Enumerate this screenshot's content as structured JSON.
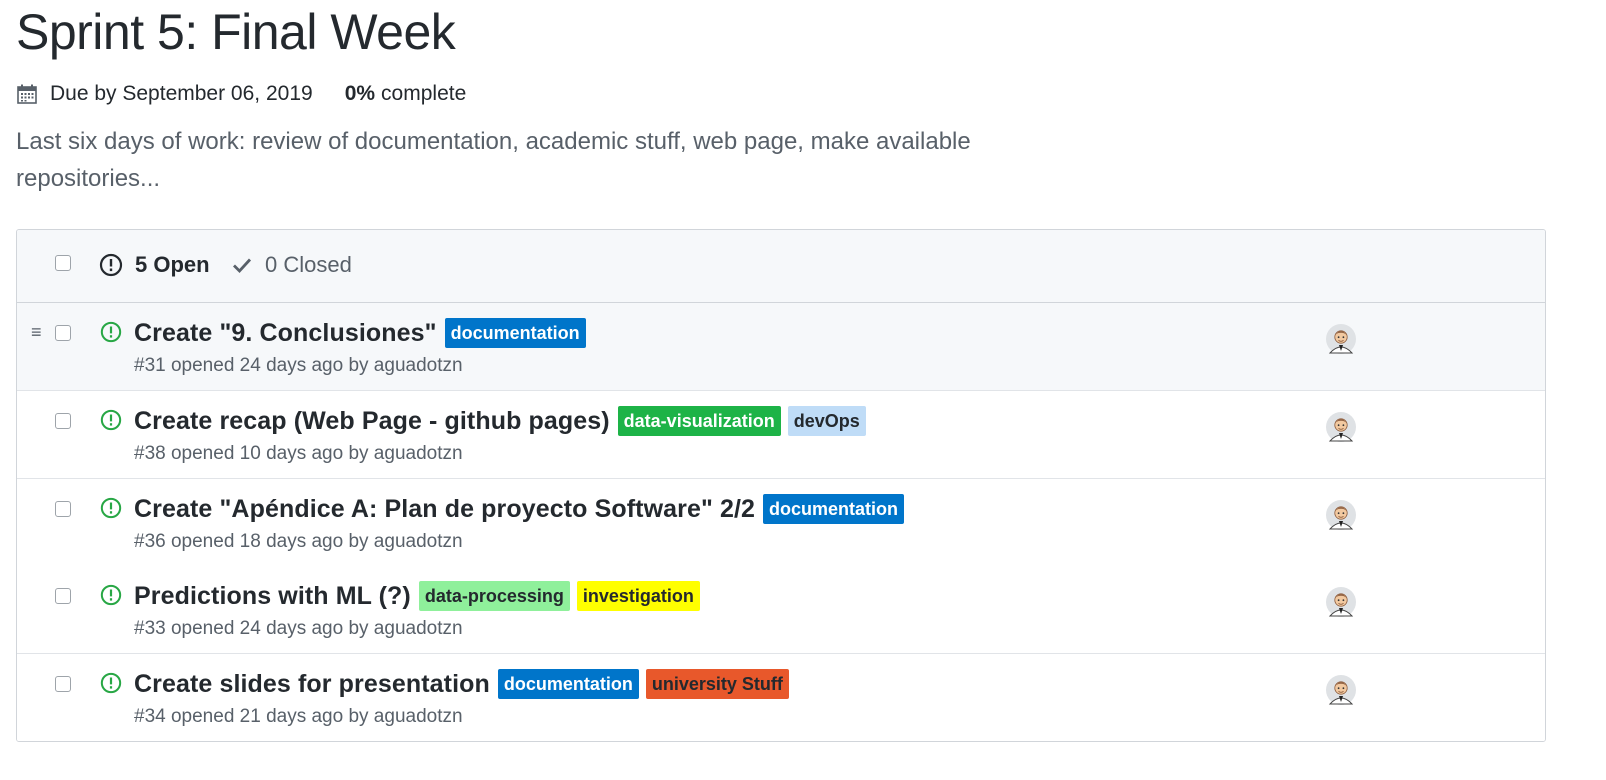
{
  "milestone": {
    "title": "Sprint 5: Final Week",
    "due": "Due by September 06, 2019",
    "percent": "0%",
    "percent_label": "complete",
    "description": "Last six days of work: review of documentation, academic stuff, web page, make available repositories..."
  },
  "tabs": {
    "open": "5 Open",
    "closed": "0 Closed"
  },
  "colors": {
    "open_icon": "#28a745",
    "documentation": "#0075ca",
    "data-visualization": "#1db347",
    "devOps": "#bfdcf7",
    "data-processing": "#8ff09b",
    "investigation": "#ffff00",
    "university Stuff": "#e8582b"
  },
  "issues": [
    {
      "title": "Create \"9. Conclusiones\"",
      "meta": "#31 opened 24 days ago by aguadotzn",
      "labels": [
        {
          "name": "documentation"
        }
      ]
    },
    {
      "title": "Create recap (Web Page - github pages)",
      "meta": "#38 opened 10 days ago by aguadotzn",
      "labels": [
        {
          "name": "data-visualization"
        },
        {
          "name": "devOps"
        }
      ]
    },
    {
      "title": "Create \"Apéndice A: Plan de proyecto Software\" 2/2",
      "meta": "#36 opened 18 days ago by aguadotzn",
      "labels": [
        {
          "name": "documentation"
        }
      ]
    },
    {
      "title": "Predictions with ML (?)",
      "meta": "#33 opened 24 days ago by aguadotzn",
      "labels": [
        {
          "name": "data-processing"
        },
        {
          "name": "investigation"
        }
      ]
    },
    {
      "title": "Create slides for presentation",
      "meta": "#34 opened 21 days ago by aguadotzn",
      "labels": [
        {
          "name": "documentation"
        },
        {
          "name": "university Stuff"
        }
      ]
    }
  ]
}
